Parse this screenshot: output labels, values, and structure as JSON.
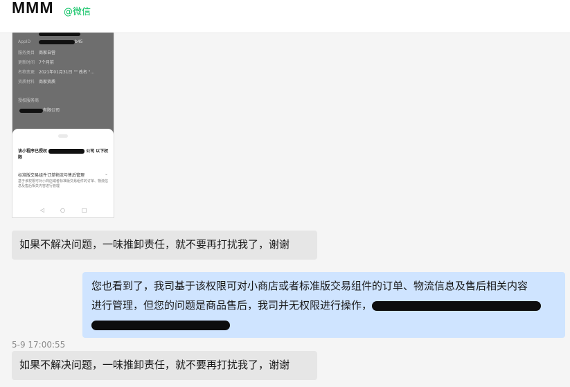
{
  "header": {
    "title": "MMM",
    "source": "@微信"
  },
  "thumbnail": {
    "rows": [
      {
        "key": "AppID",
        "value": "b45"
      },
      {
        "key": "服务类目",
        "value": "商家自营"
      },
      {
        "key": "更新时间",
        "value": "7个月前"
      },
      {
        "key": "名称变更",
        "value": "2021年01月31日 \"\" 改名 \"..."
      },
      {
        "key": "资质材料",
        "value": "商家资质"
      }
    ],
    "section_label": "授权服务商",
    "company_suffix": "有限公司",
    "sheet_title_prefix": "该小程序已授权",
    "sheet_title_suffix": "公司 以下权限",
    "permission_name": "标准版交易组件订单物流与售后管理",
    "permission_desc": "基于该权限可对小商店或者标准版交易组件的订单、物流信息及售后相关内容进行管理",
    "nav_icons": [
      "back-icon",
      "home-icon",
      "recents-icon"
    ]
  },
  "messages": [
    {
      "text": "如果不解决问题，一味推卸责任，就不要再打扰我了，谢谢"
    },
    {
      "line1": "您也看到了，我司基于该权限可对小商店或者标准版交易组件的订单、物流信息及售后相关内容",
      "line2": "进行管理，但您的问题是商品售后，我司并无权限进行操作，"
    },
    {
      "text": "如果不解决问题，一味推卸责任，就不要再打扰我了，谢谢"
    }
  ],
  "timestamp": "5-9 17:00:55",
  "colors": {
    "incoming_bubble": "#e6e6e6",
    "outgoing_bubble": "#cfe4ff",
    "source_green": "#07c160"
  }
}
